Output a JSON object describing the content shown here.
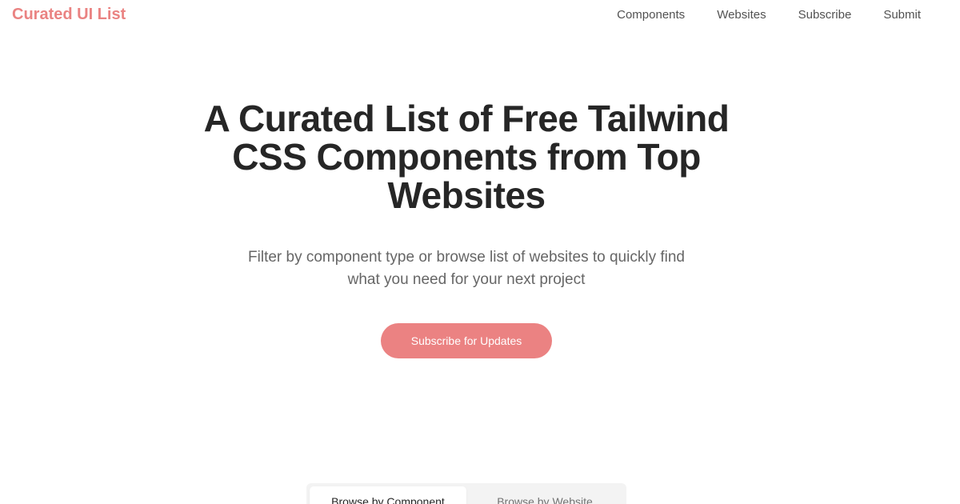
{
  "header": {
    "logo": "Curated UI List",
    "nav": [
      "Components",
      "Websites",
      "Subscribe",
      "Submit"
    ]
  },
  "hero": {
    "title": "A Curated List of Free Tailwind CSS Components from Top Websites",
    "subtitle": "Filter by component type or browse list of websites to quickly find what you need for your next project",
    "cta_label": "Subscribe for Updates"
  },
  "browse_tabs": {
    "items": [
      "Browse by Component",
      "Browse by Website"
    ],
    "active_index": 0
  },
  "colors": {
    "accent": "#eb8282",
    "heading": "#262626",
    "muted": "#666666"
  }
}
